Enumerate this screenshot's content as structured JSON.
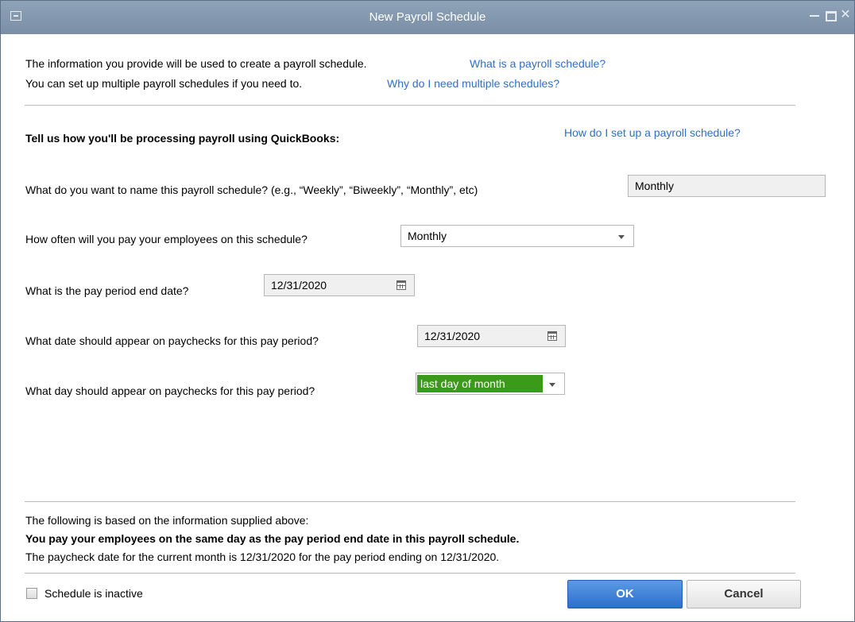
{
  "window": {
    "title": "New Payroll Schedule",
    "close_glyph": "✕",
    "icons": [
      "system-menu-icon",
      "minimize-icon",
      "maximize-icon",
      "close-icon"
    ]
  },
  "intro": {
    "line1": "The information you provide will be used to create a payroll schedule.",
    "link1": "What is a payroll schedule?",
    "line2": "You can set up multiple payroll schedules if you need to.",
    "link2": "Why do I need multiple schedules?"
  },
  "setup": {
    "heading": "Tell us how you'll be processing payroll using QuickBooks:",
    "link": "How do I set up a payroll schedule?"
  },
  "questions": {
    "name": {
      "label": "What do you want to name this payroll schedule? (e.g., “Weekly”, “Biweekly”, “Monthly”, etc)",
      "value": "Monthly"
    },
    "frequency": {
      "label": "How often will you pay your employees on this schedule?",
      "value": "Monthly"
    },
    "period_end": {
      "label": "What is the pay period end date?",
      "value": "12/31/2020"
    },
    "paycheck_date": {
      "label": "What date should appear on paychecks for this pay period?",
      "value": "12/31/2020"
    },
    "paycheck_day": {
      "label": "What day should appear on paychecks for this pay period?",
      "value": "last day of month"
    }
  },
  "summary": {
    "line1": "The following is based on the information supplied above:",
    "line2": "You pay your employees on the same day as the pay period end date in this payroll schedule.",
    "line3": "The paycheck date for the current month is 12/31/2020 for the pay period ending on 12/31/2020."
  },
  "footer": {
    "inactive_label": "Schedule is inactive",
    "inactive_checked": false,
    "ok_label": "OK",
    "cancel_label": "Cancel"
  },
  "colors": {
    "titlebar": "#7f93aa",
    "link": "#2f6fc9",
    "selection_green": "#3c9a1a",
    "ok_button": "#2c6fcb"
  }
}
